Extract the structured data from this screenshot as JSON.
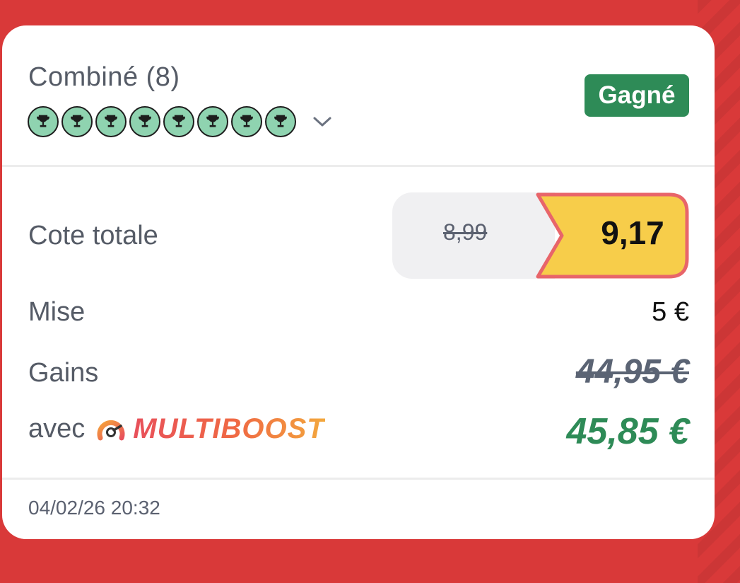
{
  "colors": {
    "background": "#d93939",
    "status_green": "#2e8b57",
    "boosted_odds_yellow": "#f7cd4a",
    "boosted_odds_border": "#e8656a",
    "leg_won": "#8fd3b0",
    "winnings_green": "#2e8b57"
  },
  "bet": {
    "type_label": "Combiné (8)",
    "status": "Gagné",
    "legs": [
      {
        "icon": "trophy-icon",
        "result": "won"
      },
      {
        "icon": "trophy-icon",
        "result": "won"
      },
      {
        "icon": "trophy-icon",
        "result": "won"
      },
      {
        "icon": "trophy-icon",
        "result": "won"
      },
      {
        "icon": "trophy-icon",
        "result": "won"
      },
      {
        "icon": "trophy-icon",
        "result": "won"
      },
      {
        "icon": "trophy-icon",
        "result": "won"
      },
      {
        "icon": "trophy-icon",
        "result": "won"
      }
    ],
    "expand_icon": "chevron-down-icon"
  },
  "odds": {
    "label": "Cote totale",
    "original": "8,99",
    "boosted": "9,17"
  },
  "stake": {
    "label": "Mise",
    "value": "5 €"
  },
  "winnings": {
    "label": "Gains",
    "original": "44,95 €",
    "boost_prefix": "avec",
    "boost_icon": "multiboost-icon",
    "boost_brand": "MULTIBOOST",
    "boosted": "45,85 €"
  },
  "timestamp": "04/02/26 20:32"
}
